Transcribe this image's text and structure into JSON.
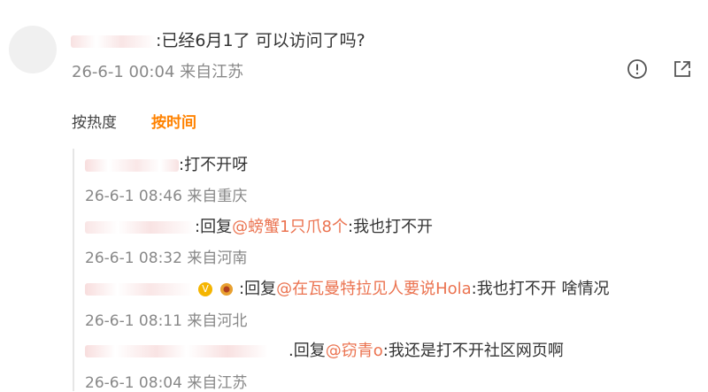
{
  "post": {
    "text": ":已经6月1了 可以访问了吗?",
    "meta": "26-6-1 00:04 来自江苏"
  },
  "icons": {
    "report": "exclamation-circle-icon",
    "share": "share-arrow-icon"
  },
  "sort_tabs": {
    "hot": "按热度",
    "time": "按时间"
  },
  "replies": [
    {
      "text": ":打不开呀",
      "meta": "26-6-1 08:46 来自重庆"
    },
    {
      "prefix": ":回复",
      "mention": "@螃蟹1只爪8个",
      "text": ":我也打不开",
      "meta": "26-6-1 08:32 来自河南"
    },
    {
      "prefix": ":回复",
      "mention": "@在瓦曼特拉见人要说Hola",
      "text": ":我也打不开 啥情况",
      "meta": "26-6-1 08:11 来自河北"
    },
    {
      "prefix": ".回复",
      "mention": "@窃青o",
      "text": ":我还是打不开社区网页啊",
      "meta": "26-6-1 08:04 来自江苏"
    }
  ],
  "colors": {
    "accent": "#ff8200",
    "mention": "#eb7350",
    "meta": "#888888"
  }
}
